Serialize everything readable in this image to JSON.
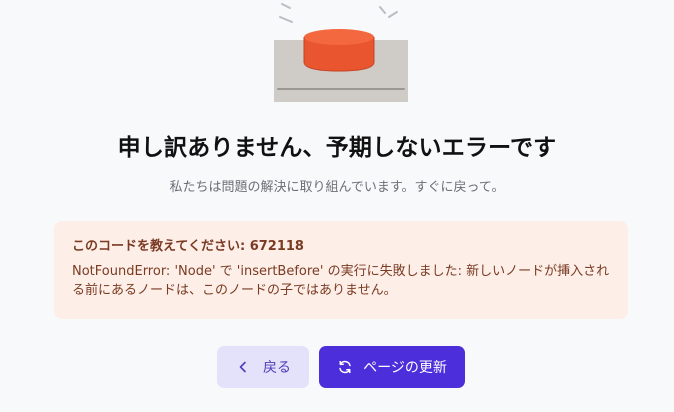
{
  "illustration": {
    "icon": "broken-red-button-illustration",
    "colors": {
      "button_top": "#f4683f",
      "button_base": "#cfcbc6",
      "motion_lines": "#b9bec4"
    }
  },
  "title": "申し訳ありません、予期しないエラーです",
  "subtitle": "私たちは問題の解決に取り組んでいます。すぐに戻って。",
  "error": {
    "code_label": "このコードを教えてください: ",
    "code_value": "672118",
    "message": "NotFoundError: 'Node' で 'insertBefore' の実行に失敗しました: 新しいノードが挿入される前にあるノードは、このノードの子ではありません。",
    "colors": {
      "background": "#fdeee8",
      "text": "#7a3b22"
    }
  },
  "actions": {
    "back_label": "戻る",
    "back_icon": "chevron-left-icon",
    "reload_label": "ページの更新",
    "reload_icon": "refresh-icon"
  },
  "colors": {
    "primary": "#4c2fdb",
    "secondary_bg": "#e4e1fb",
    "page_bg": "#f8f9fb"
  }
}
